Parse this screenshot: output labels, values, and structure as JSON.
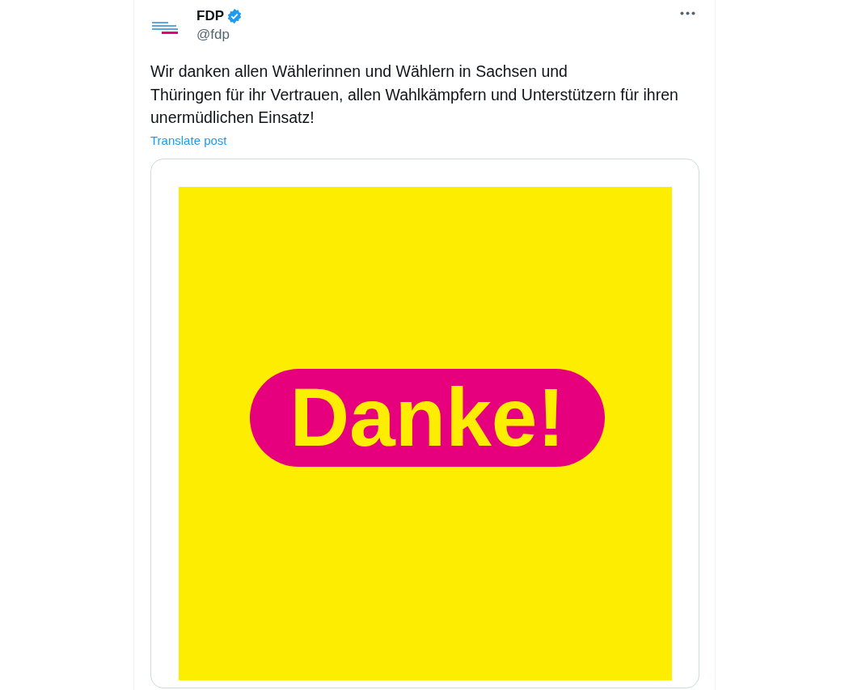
{
  "post": {
    "author": {
      "name": "FDP",
      "verified": true,
      "handle": "@fdp"
    },
    "text": "Wir danken allen Wählerinnen und Wählern in Sachsen und\nThüringen für ihr Vertrauen, allen Wahlkämpfern und Unterstützern für ihren unermüdlichen Einsatz!",
    "translate_link": "Translate post",
    "media": {
      "kind": "graphic",
      "badge_text": "Danke!"
    }
  }
}
